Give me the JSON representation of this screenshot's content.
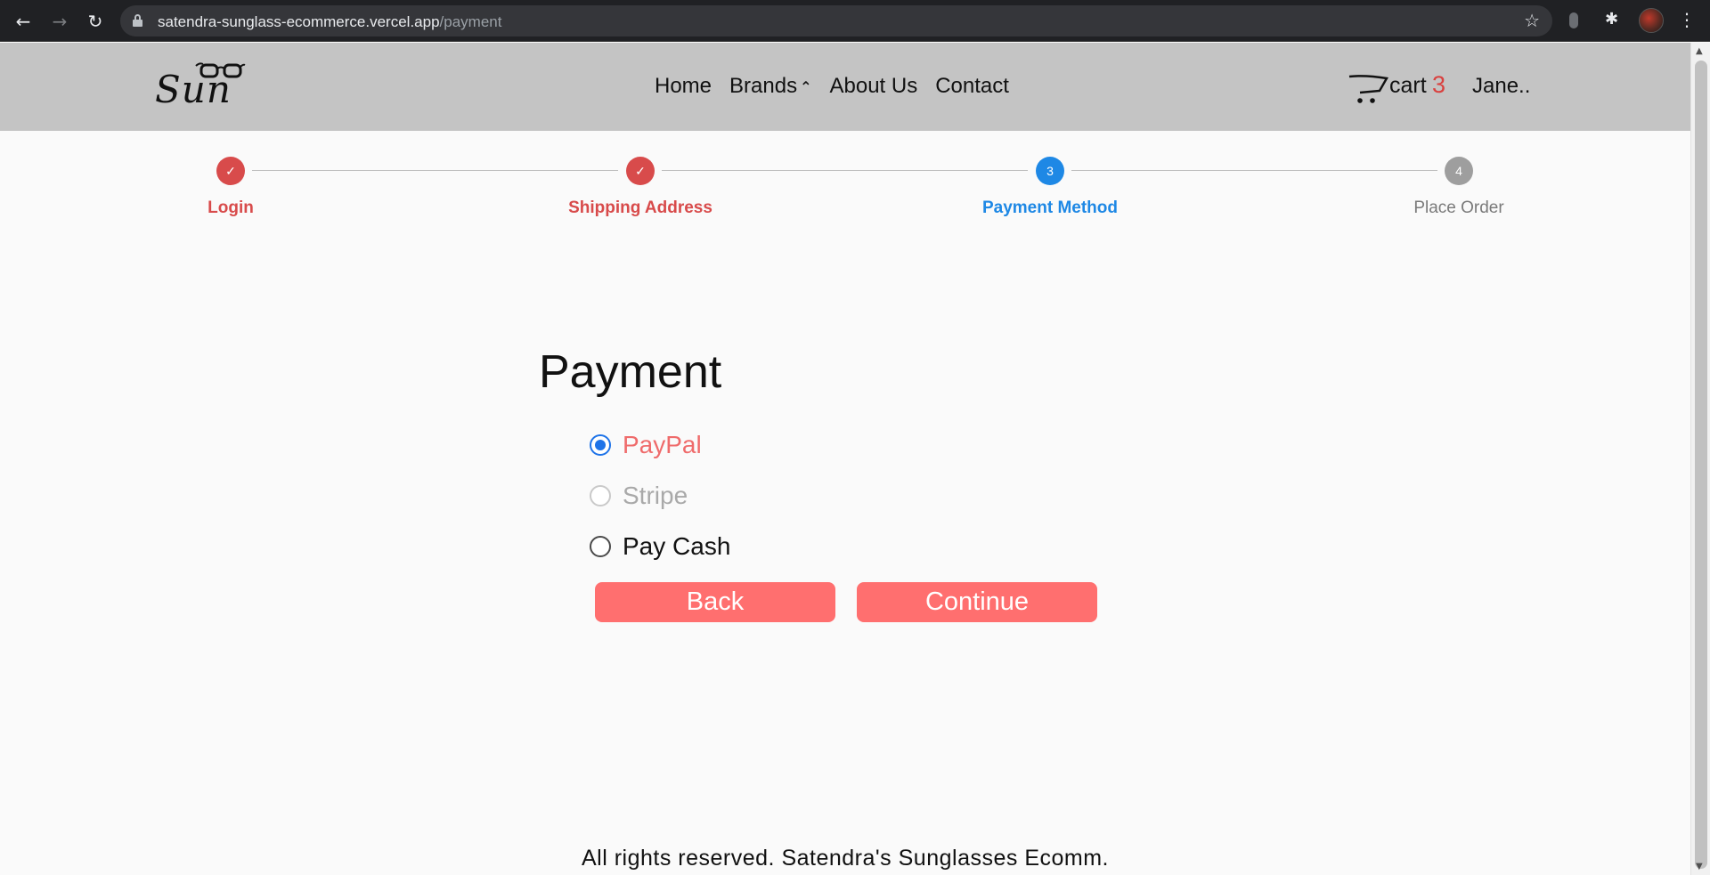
{
  "browser": {
    "url_host": "satendra-sunglass-ecommerce.vercel.app",
    "url_path": "/payment",
    "back_icon": "←",
    "forward_icon": "→",
    "reload_icon": "↻",
    "star_icon": "☆",
    "extensions_icon": "✱",
    "menu_icon": "⋮"
  },
  "header": {
    "logo_text": "Sun",
    "nav": [
      {
        "label": "Home"
      },
      {
        "label": "Brands",
        "caret": "⌃"
      },
      {
        "label": "About Us"
      },
      {
        "label": "Contact"
      }
    ],
    "cart_label": "cart",
    "cart_count": "3",
    "user_name": "Jane.."
  },
  "stepper": {
    "steps": [
      {
        "label": "Login",
        "state": "done",
        "marker": "✓"
      },
      {
        "label": "Shipping Address",
        "state": "done",
        "marker": "✓"
      },
      {
        "label": "Payment Method",
        "state": "active",
        "marker": "3"
      },
      {
        "label": "Place Order",
        "state": "todo",
        "marker": "4"
      }
    ]
  },
  "payment": {
    "title": "Payment",
    "options": [
      {
        "label": "PayPal",
        "checked": true,
        "disabled": false
      },
      {
        "label": "Stripe",
        "checked": false,
        "disabled": true
      },
      {
        "label": "Pay Cash",
        "checked": false,
        "disabled": false
      }
    ],
    "back_label": "Back",
    "continue_label": "Continue"
  },
  "footer": {
    "text": "All rights reserved. Satendra's Sunglasses Ecomm."
  },
  "colors": {
    "accent_red": "#d84b4b",
    "button_coral": "#ff6f6f",
    "active_blue": "#1e88e5",
    "header_gray": "#c4c4c4"
  }
}
